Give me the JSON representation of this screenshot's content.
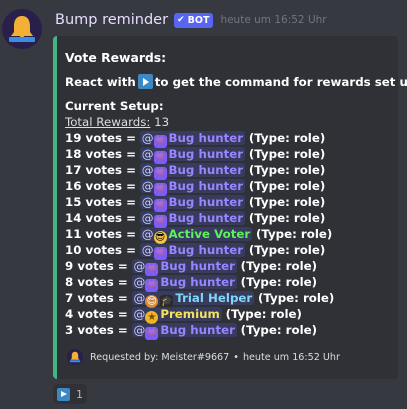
{
  "message": {
    "author": "Bump reminder",
    "bot_tag": "BOT",
    "timestamp": "heute um 16:52 Uhr"
  },
  "embed": {
    "accent_color": "#43b581",
    "title": "Vote Rewards:",
    "instruction_prefix": "React with",
    "instruction_suffix": "to get the command for rewards set up!",
    "setup_title": "Current Setup:",
    "total_label": "Total Rewards:",
    "total_value": "13",
    "rewards": [
      {
        "votes": "19 votes =",
        "role": "Bug hunter",
        "icon": "bug-icon",
        "color": "#9b84ff",
        "type": "(Type: role)"
      },
      {
        "votes": "18 votes =",
        "role": "Bug hunter",
        "icon": "bug-icon",
        "color": "#9b84ff",
        "type": "(Type: role)"
      },
      {
        "votes": "17 votes =",
        "role": "Bug hunter",
        "icon": "bug-icon",
        "color": "#9b84ff",
        "type": "(Type: role)"
      },
      {
        "votes": "16 votes =",
        "role": "Bug hunter",
        "icon": "bug-icon",
        "color": "#9b84ff",
        "type": "(Type: role)"
      },
      {
        "votes": "15 votes =",
        "role": "Bug hunter",
        "icon": "bug-icon",
        "color": "#9b84ff",
        "type": "(Type: role)"
      },
      {
        "votes": "14 votes =",
        "role": "Bug hunter",
        "icon": "bug-icon",
        "color": "#9b84ff",
        "type": "(Type: role)"
      },
      {
        "votes": "11 votes =",
        "role": "Active Voter",
        "icon": "sunglasses-icon",
        "color": "#5df25d",
        "type": "(Type: role)"
      },
      {
        "votes": "10 votes =",
        "role": "Bug hunter",
        "icon": "bug-icon",
        "color": "#9b84ff",
        "type": "(Type: role)"
      },
      {
        "votes": "9 votes =",
        "role": "Bug hunter",
        "icon": "bug-icon",
        "color": "#9b84ff",
        "type": "(Type: role)"
      },
      {
        "votes": "8 votes =",
        "role": "Bug hunter",
        "icon": "bug-icon",
        "color": "#9b84ff",
        "type": "(Type: role)"
      },
      {
        "votes": "7 votes =",
        "role": "Trial Helper",
        "icon": "graduation-cap-icon",
        "color": "#7fd6f5",
        "type": "(Type: role)"
      },
      {
        "votes": "4 votes =",
        "role": "Premium",
        "icon": "star-icon",
        "color": "#f5e35b",
        "type": "(Type: role)"
      },
      {
        "votes": "3 votes =",
        "role": "Bug hunter",
        "icon": "bug-icon",
        "color": "#9b84ff",
        "type": "(Type: role)"
      }
    ],
    "footer": {
      "text": "Requested by: Meister#9667",
      "separator": "•",
      "timestamp": "heute um 16:52 Uhr"
    }
  },
  "reaction": {
    "emoji": "arrow-forward-icon",
    "count": "1"
  }
}
